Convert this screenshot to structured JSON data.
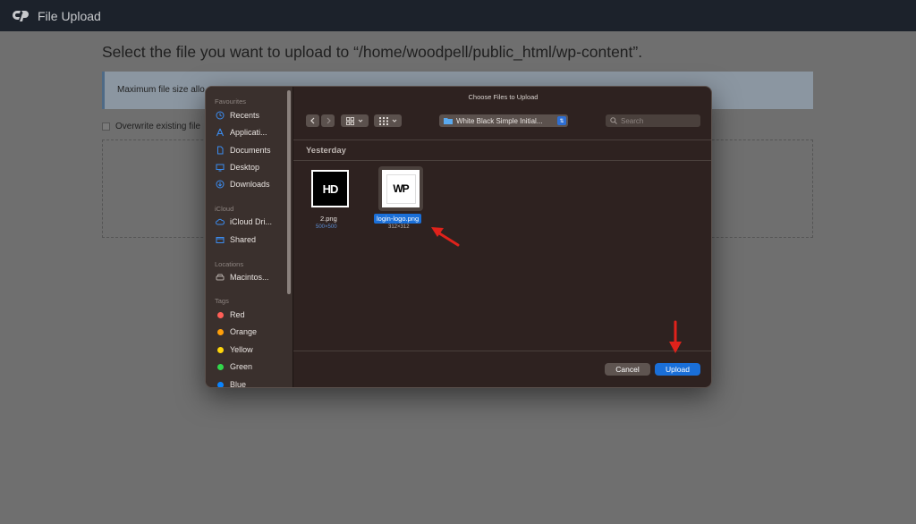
{
  "header": {
    "title": "File Upload"
  },
  "page": {
    "heading": "Select the file you want to upload to “/home/woodpell/public_html/wp-content”.",
    "info_text": "Maximum file size allo",
    "overwrite_label": "Overwrite existing file"
  },
  "dialog": {
    "title": "Choose Files to Upload",
    "sidebar": {
      "favourites_heading": "Favourites",
      "favourites": [
        "Recents",
        "Applicati...",
        "Documents",
        "Desktop",
        "Downloads"
      ],
      "icloud_heading": "iCloud",
      "icloud": [
        "iCloud Dri...",
        "Shared"
      ],
      "locations_heading": "Locations",
      "locations": [
        "Macintos..."
      ],
      "tags_heading": "Tags",
      "tags": [
        {
          "label": "Red",
          "color": "#ff5f57"
        },
        {
          "label": "Orange",
          "color": "#ff9f0a"
        },
        {
          "label": "Yellow",
          "color": "#ffd60a"
        },
        {
          "label": "Green",
          "color": "#32d74b"
        },
        {
          "label": "Blue",
          "color": "#0a84ff"
        }
      ]
    },
    "toolbar": {
      "folder": "White Black Simple Initial...",
      "search_placeholder": "Search"
    },
    "section": "Yesterday",
    "files": [
      {
        "name": "2.png",
        "dims": "500×500",
        "logo_text": "HD",
        "selected": false
      },
      {
        "name": "login-logo.png",
        "dims": "312×312",
        "logo_text": "WP",
        "selected": true
      }
    ],
    "buttons": {
      "cancel": "Cancel",
      "upload": "Upload"
    }
  },
  "colors": {
    "accent": "#1a6fd8",
    "annotation_arrow": "#e0221b"
  }
}
